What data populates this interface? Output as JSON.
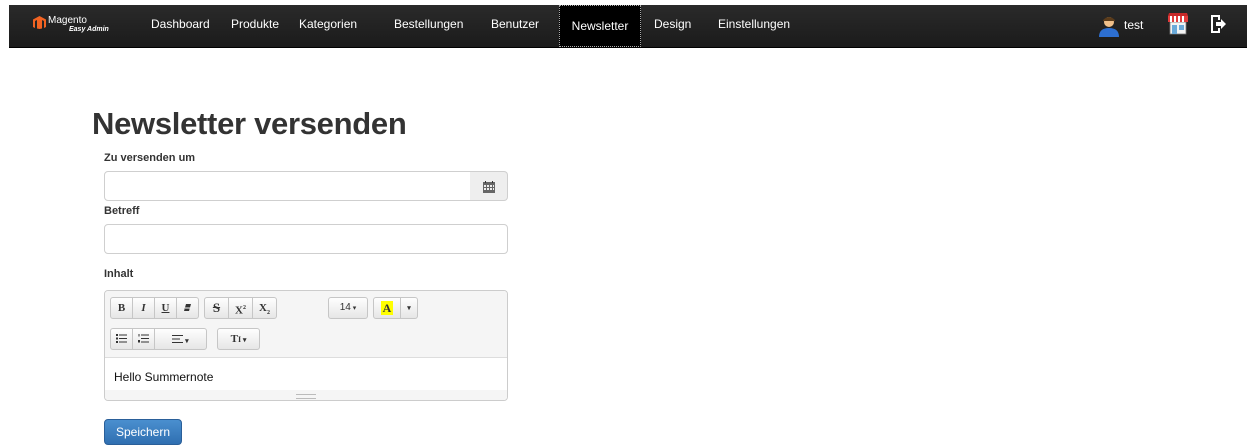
{
  "navbar": {
    "brand_name": "Magento",
    "brand_sub": "Easy Admin",
    "items": [
      {
        "label": "Dashboard",
        "active": false
      },
      {
        "label": "Produkte",
        "active": false
      },
      {
        "label": "Kategorien",
        "active": false
      },
      {
        "label": "Bestellungen",
        "active": false
      },
      {
        "label": "Benutzer",
        "active": false
      },
      {
        "label": "Newsletter",
        "active": true
      },
      {
        "label": "Design",
        "active": false
      },
      {
        "label": "Einstellungen",
        "active": false
      }
    ],
    "user_name": "test",
    "icons": [
      "magento-logo-icon",
      "user-avatar-icon",
      "shop-icon",
      "logout-icon"
    ]
  },
  "page": {
    "title": "Newsletter versenden",
    "send_at_label": "Zu versenden um",
    "send_at_value": "",
    "subject_label": "Betreff",
    "subject_value": "",
    "content_label": "Inhalt",
    "content_text": "Hello Summernote",
    "save_label": "Speichern"
  },
  "editor_toolbar": {
    "bold": "B",
    "italic": "I",
    "underline": "U",
    "strikethrough": "S",
    "superscript": "X",
    "subscript": "X",
    "font_size": "14",
    "color": "A",
    "line_height": "T"
  },
  "colors": {
    "navbar_bg": "#1f1f1f",
    "primary_button": "#3574b8",
    "highlight_yellow": "#ffff00"
  }
}
